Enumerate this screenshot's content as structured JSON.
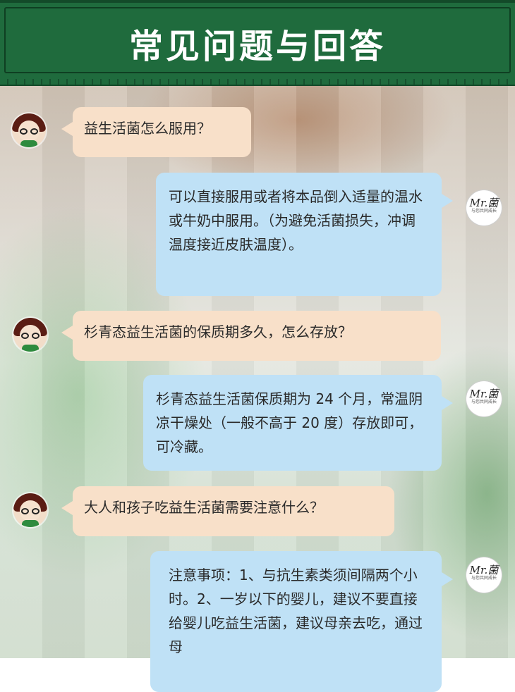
{
  "header": {
    "title": "常见问题与回答"
  },
  "answer_avatar": {
    "mark": "Mr.菌",
    "caption": "与您共同成长"
  },
  "messages": [
    {
      "role": "question",
      "text": "益生活菌怎么服用？"
    },
    {
      "role": "answer",
      "text": "可以直接服用或者将本品倒入适量的温水或牛奶中服用。（为避免活菌损失，冲调温度接近皮肤温度）。"
    },
    {
      "role": "question",
      "text": "杉青态益生活菌的保质期多久，怎么存放？"
    },
    {
      "role": "answer",
      "text": "杉青态益生活菌保质期为 24 个月，常温阴凉干燥处（一般不高于 20 度）存放即可，可冷藏。"
    },
    {
      "role": "question",
      "text": "大人和孩子吃益生活菌需要注意什么？"
    },
    {
      "role": "answer",
      "text": "注意事项：1、与抗生素类须间隔两个小时。2、一岁以下的婴儿，建议不要直接给婴儿吃益生活菌，建议母亲去吃，通过母"
    }
  ]
}
